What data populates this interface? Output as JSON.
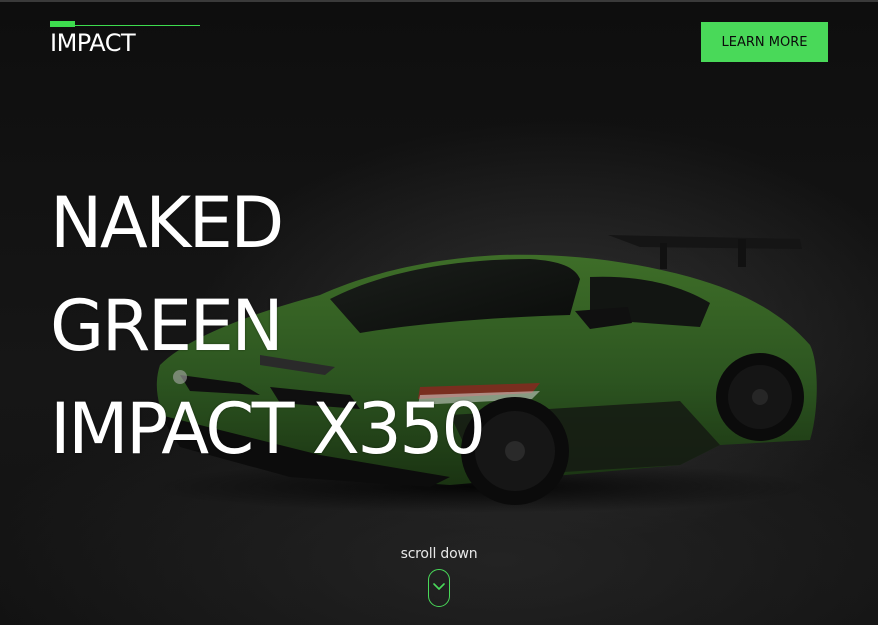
{
  "brand": {
    "name": "IMPACT",
    "accent": "#49d959"
  },
  "header": {
    "cta_label": "LEARN MORE"
  },
  "hero": {
    "headline_lines": [
      "NAKED",
      "GREEN",
      "IMPACT X350"
    ],
    "image": {
      "icon": "sports-car-image",
      "color": "#2f5a1f"
    }
  },
  "scroll": {
    "label": "scroll down",
    "icon": "chevron-down-icon"
  }
}
